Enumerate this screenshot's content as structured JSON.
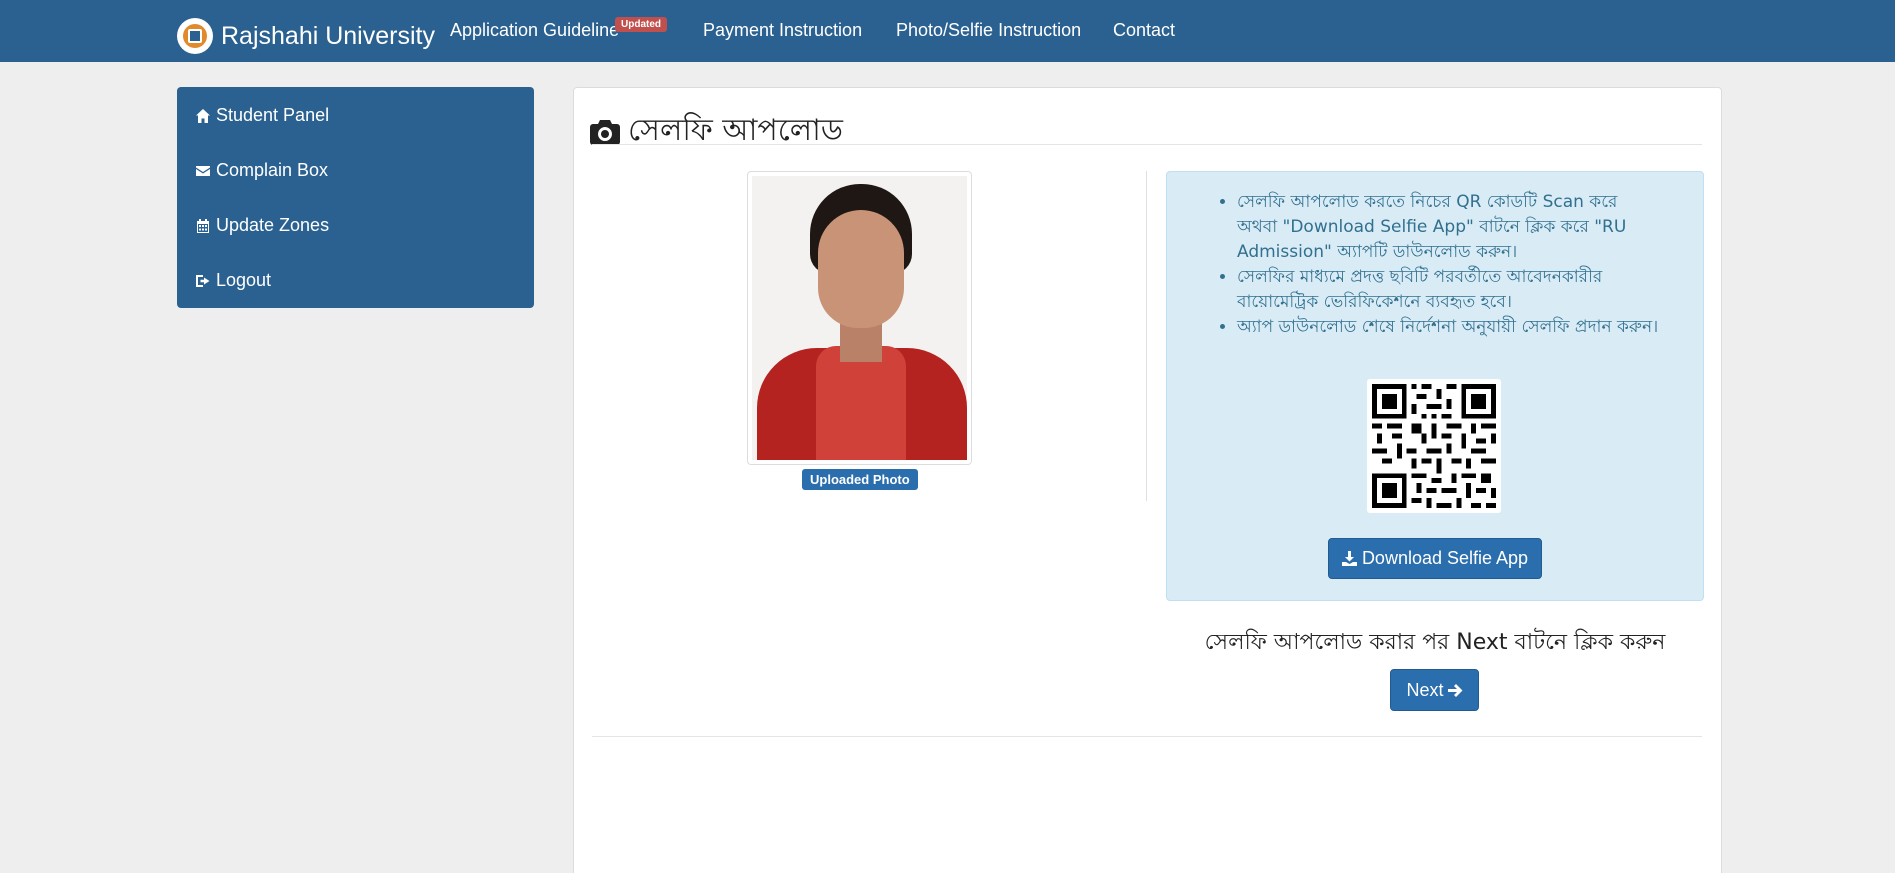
{
  "navbar": {
    "brand": "Rajshahi University",
    "links": [
      {
        "label": "Application Guideline"
      },
      {
        "label": "Payment Instruction"
      },
      {
        "label": "Photo/Selfie Instruction"
      },
      {
        "label": "Contact"
      }
    ],
    "badge": "Updated"
  },
  "sidebar": {
    "items": [
      {
        "label": "Student Panel",
        "icon": "home-icon"
      },
      {
        "label": "Complain Box",
        "icon": "envelope-icon"
      },
      {
        "label": "Update Zones",
        "icon": "calendar-icon"
      },
      {
        "label": "Logout",
        "icon": "sign-out-icon"
      }
    ]
  },
  "main": {
    "title": "সেলফি আপলোড",
    "photo_badge": "Uploaded Photo",
    "instructions": [
      "সেলফি আপলোড করতে নিচের QR কোডটি Scan করে অথবা \"Download Selfie App\" বাটনে ক্লিক করে \"RU Admission\" অ্যাপটি ডাউনলোড করুন।",
      "সেলফির মাধ্যমে প্রদত্ত ছবিটি পরবর্তীতে আবেদনকারীর বায়োমেট্রিক ভেরিফিকেশনে ব্যবহৃত হবে।",
      "অ্যাপ ডাউনলোড শেষে নির্দেশনা অনুযায়ী সেলফি প্রদান করুন।"
    ],
    "download_button": "Download Selfie App",
    "after_upload_text": "সেলফি আপলোড করার পর Next বাটনে ক্লিক করুন",
    "next_button": "Next"
  },
  "colors": {
    "primary": "#2a6190",
    "button": "#2a6ead",
    "info_bg": "#d9ecf6",
    "info_text": "#31708f",
    "badge": "#c0504d"
  }
}
